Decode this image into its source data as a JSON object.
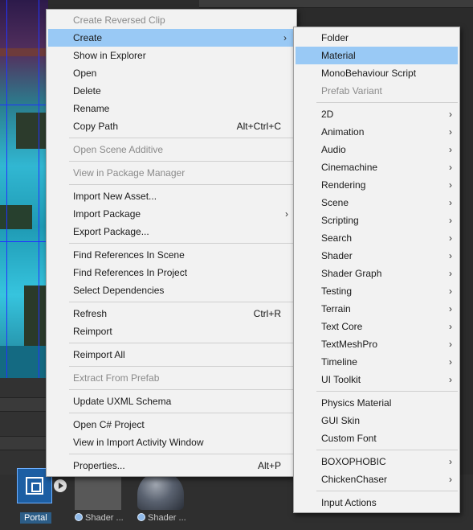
{
  "colors": {
    "menu_bg": "#f2f2f2",
    "highlight": "#99c9f5",
    "disabled_text": "#8a8a8a",
    "separator": "#cfcfcf"
  },
  "context_menu": {
    "items": [
      {
        "label": "Create Reversed Clip",
        "disabled": true
      },
      {
        "label": "Create",
        "submenu": true,
        "highlighted": true
      },
      {
        "label": "Show in Explorer"
      },
      {
        "label": "Open"
      },
      {
        "label": "Delete"
      },
      {
        "label": "Rename"
      },
      {
        "label": "Copy Path",
        "shortcut": "Alt+Ctrl+C"
      },
      {
        "label": "Open Scene Additive",
        "disabled": true
      },
      {
        "label": "View in Package Manager",
        "disabled": true
      },
      {
        "label": "Import New Asset..."
      },
      {
        "label": "Import Package",
        "submenu": true
      },
      {
        "label": "Export Package..."
      },
      {
        "label": "Find References In Scene"
      },
      {
        "label": "Find References In Project"
      },
      {
        "label": "Select Dependencies"
      },
      {
        "label": "Refresh",
        "shortcut": "Ctrl+R"
      },
      {
        "label": "Reimport"
      },
      {
        "label": "Reimport All"
      },
      {
        "label": "Extract From Prefab",
        "disabled": true
      },
      {
        "label": "Update UXML Schema"
      },
      {
        "label": "Open C# Project"
      },
      {
        "label": "View in Import Activity Window"
      },
      {
        "label": "Properties...",
        "shortcut": "Alt+P"
      }
    ]
  },
  "create_submenu": {
    "items": [
      {
        "label": "Folder"
      },
      {
        "label": "Material",
        "highlighted": true
      },
      {
        "label": "MonoBehaviour Script"
      },
      {
        "label": "Prefab Variant",
        "disabled": true
      },
      {
        "label": "2D",
        "submenu": true
      },
      {
        "label": "Animation",
        "submenu": true
      },
      {
        "label": "Audio",
        "submenu": true
      },
      {
        "label": "Cinemachine",
        "submenu": true
      },
      {
        "label": "Rendering",
        "submenu": true
      },
      {
        "label": "Scene",
        "submenu": true
      },
      {
        "label": "Scripting",
        "submenu": true
      },
      {
        "label": "Search",
        "submenu": true
      },
      {
        "label": "Shader",
        "submenu": true
      },
      {
        "label": "Shader Graph",
        "submenu": true
      },
      {
        "label": "Testing",
        "submenu": true
      },
      {
        "label": "Terrain",
        "submenu": true
      },
      {
        "label": "Text Core",
        "submenu": true
      },
      {
        "label": "TextMeshPro",
        "submenu": true
      },
      {
        "label": "Timeline",
        "submenu": true
      },
      {
        "label": "UI Toolkit",
        "submenu": true
      },
      {
        "label": "Physics Material"
      },
      {
        "label": "GUI Skin"
      },
      {
        "label": "Custom Font"
      },
      {
        "label": "BOXOPHOBIC",
        "submenu": true
      },
      {
        "label": "ChickenChaser",
        "submenu": true
      },
      {
        "label": "Input Actions"
      }
    ]
  },
  "project_assets": [
    {
      "label": "Portal",
      "icon": "prefab-icon"
    },
    {
      "label": "Shader ...",
      "icon": "shader-icon"
    },
    {
      "label": "Shader ...",
      "icon": "shader-icon"
    }
  ]
}
